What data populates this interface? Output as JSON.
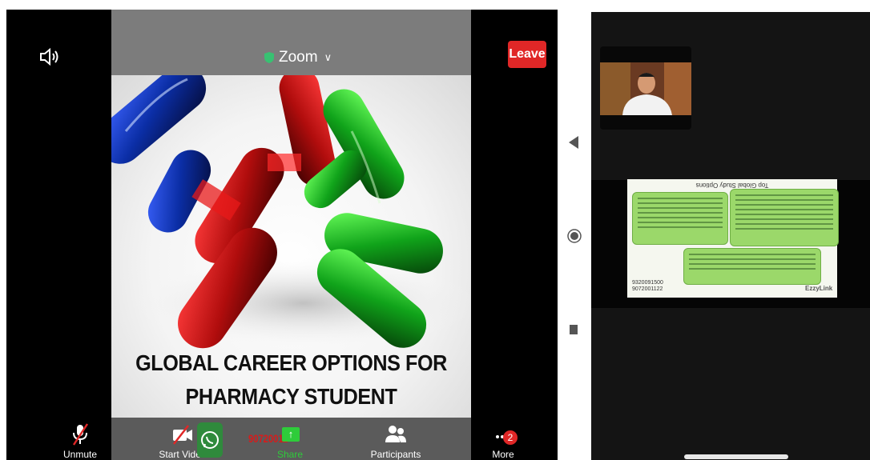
{
  "zoom": {
    "title": "Zoom",
    "leave_label": "Leave",
    "slide_title_line1": "GLOBAL CAREER OPTIONS FOR",
    "slide_title_line2": "PHARMACY STUDENT",
    "toolbar": {
      "unmute": "Unmute",
      "start_video": "Start Video",
      "share": "Share",
      "participants": "Participants",
      "more": "More",
      "more_badge": "2"
    },
    "overlay_number": "90720011",
    "overlay_arrow": "↑"
  },
  "second_screen": {
    "mini_slide_title": "Top Global Study Options",
    "mini_phone_1": "9320091500",
    "mini_phone_2": "9072001122",
    "mini_logo": "EzzyLink"
  },
  "colors": {
    "leave": "#e02727",
    "shield": "#38c172",
    "badge": "#e02727"
  },
  "icons": {
    "speaker": "speaker-icon",
    "shield": "shield-icon",
    "mic_muted": "mic-muted-icon",
    "video_off": "video-off-icon",
    "share": "share-icon",
    "participants": "participants-icon",
    "more": "more-icon",
    "whatsapp": "whatsapp-icon",
    "back": "back-triangle-icon",
    "home": "home-circle-icon",
    "recent": "recent-square-icon"
  }
}
